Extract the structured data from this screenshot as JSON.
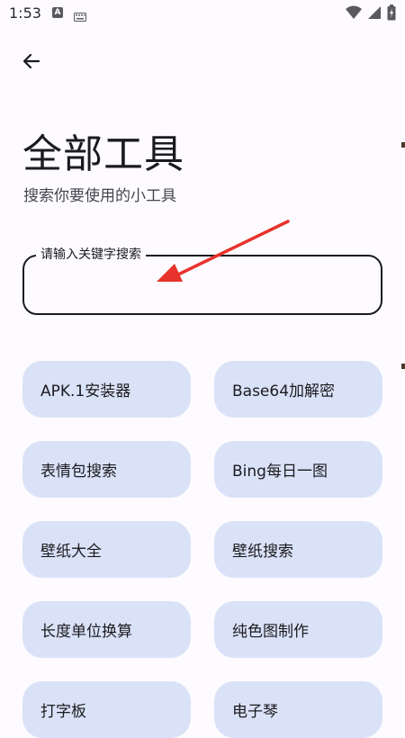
{
  "status_bar": {
    "time": "1:53",
    "notification_icon_letter": "A",
    "icons": [
      "a-notification-icon",
      "keyboard-icon",
      "wifi-icon",
      "signal-icon",
      "battery-icon"
    ]
  },
  "header": {
    "back_icon": "arrow-left-icon",
    "title": "全部工具",
    "subtitle": "搜索你要使用的小工具"
  },
  "search": {
    "label": "请输入关键字搜索",
    "value": "",
    "placeholder": ""
  },
  "annotation": {
    "arrow_color": "#e8322c"
  },
  "tools": [
    {
      "label": "APK.1安装器"
    },
    {
      "label": "Base64加解密"
    },
    {
      "label": "表情包搜索"
    },
    {
      "label": "Bing每日一图"
    },
    {
      "label": "壁纸大全"
    },
    {
      "label": "壁纸搜索"
    },
    {
      "label": "长度单位换算"
    },
    {
      "label": "纯色图制作"
    },
    {
      "label": "打字板"
    },
    {
      "label": "电子琴"
    }
  ],
  "colors": {
    "background": "#fdfbff",
    "chip": "#dae2f8",
    "text": "#1b1b1f"
  }
}
